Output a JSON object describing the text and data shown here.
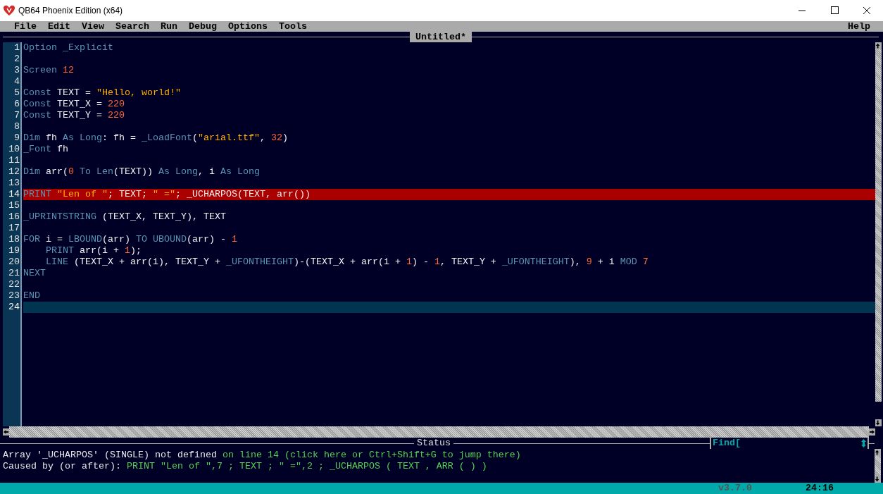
{
  "window": {
    "title": "QB64 Phoenix Edition (x64)"
  },
  "menu": {
    "items": [
      "File",
      "Edit",
      "View",
      "Search",
      "Run",
      "Debug",
      "Options",
      "Tools"
    ],
    "help": "Help"
  },
  "editor": {
    "tab": "Untitled*",
    "lines": [
      {
        "number": "1",
        "error": false,
        "current": false,
        "tokens": [
          {
            "kind": "keyword",
            "text": "Option _Explicit"
          }
        ]
      },
      {
        "number": "2",
        "error": false,
        "current": false
      },
      {
        "number": "3",
        "error": false,
        "current": false,
        "tokens": [
          {
            "kind": "keyword",
            "text": "Screen "
          },
          {
            "kind": "number",
            "text": "12"
          }
        ]
      },
      {
        "number": "4",
        "error": false,
        "current": false
      },
      {
        "number": "5",
        "error": false,
        "current": false,
        "tokens": [
          {
            "kind": "keyword",
            "text": "Const "
          },
          {
            "kind": "plain",
            "text": "TEXT = "
          },
          {
            "kind": "string",
            "text": "\"Hello, world!\""
          }
        ]
      },
      {
        "number": "6",
        "error": false,
        "current": false,
        "tokens": [
          {
            "kind": "keyword",
            "text": "Const "
          },
          {
            "kind": "plain",
            "text": "TEXT_X = "
          },
          {
            "kind": "number",
            "text": "220"
          }
        ]
      },
      {
        "number": "7",
        "error": false,
        "current": false,
        "tokens": [
          {
            "kind": "keyword",
            "text": "Const "
          },
          {
            "kind": "plain",
            "text": "TEXT_Y = "
          },
          {
            "kind": "number",
            "text": "220"
          }
        ]
      },
      {
        "number": "8",
        "error": false,
        "current": false
      },
      {
        "number": "9",
        "error": false,
        "current": false,
        "tokens": [
          {
            "kind": "keyword",
            "text": "Dim "
          },
          {
            "kind": "plain",
            "text": "fh "
          },
          {
            "kind": "keyword",
            "text": "As Long"
          },
          {
            "kind": "plain",
            "text": ": fh = "
          },
          {
            "kind": "keyword",
            "text": "_LoadFont"
          },
          {
            "kind": "plain",
            "text": "("
          },
          {
            "kind": "string",
            "text": "\"arial.ttf\""
          },
          {
            "kind": "plain",
            "text": ", "
          },
          {
            "kind": "number",
            "text": "32"
          },
          {
            "kind": "plain",
            "text": ")"
          }
        ]
      },
      {
        "number": "10",
        "error": false,
        "current": false,
        "tokens": [
          {
            "kind": "keyword",
            "text": "_Font "
          },
          {
            "kind": "plain",
            "text": "fh"
          }
        ]
      },
      {
        "number": "11",
        "error": false,
        "current": false
      },
      {
        "number": "12",
        "error": false,
        "current": false,
        "tokens": [
          {
            "kind": "keyword",
            "text": "Dim "
          },
          {
            "kind": "plain",
            "text": "arr("
          },
          {
            "kind": "number",
            "text": "0"
          },
          {
            "kind": "keyword",
            "text": " To Len"
          },
          {
            "kind": "plain",
            "text": "(TEXT)) "
          },
          {
            "kind": "keyword",
            "text": "As Long"
          },
          {
            "kind": "plain",
            "text": ", i "
          },
          {
            "kind": "keyword",
            "text": "As Long"
          }
        ]
      },
      {
        "number": "13",
        "error": false,
        "current": false
      },
      {
        "number": "14",
        "error": true,
        "current": false,
        "tokens": [
          {
            "kind": "keyword",
            "text": "PRINT "
          },
          {
            "kind": "string",
            "text": "\"Len of \""
          },
          {
            "kind": "plain",
            "text": "; TEXT; "
          },
          {
            "kind": "string",
            "text": "\" =\""
          },
          {
            "kind": "plain",
            "text": "; _UCHARPOS(TEXT, arr())"
          }
        ]
      },
      {
        "number": "15",
        "error": false,
        "current": false
      },
      {
        "number": "16",
        "error": false,
        "current": false,
        "tokens": [
          {
            "kind": "keyword",
            "text": "_UPRINTSTRING "
          },
          {
            "kind": "plain",
            "text": "(TEXT_X, TEXT_Y), TEXT"
          }
        ]
      },
      {
        "number": "17",
        "error": false,
        "current": false
      },
      {
        "number": "18",
        "error": false,
        "current": false,
        "tokens": [
          {
            "kind": "keyword",
            "text": "FOR "
          },
          {
            "kind": "plain",
            "text": "i = "
          },
          {
            "kind": "keyword",
            "text": "LBOUND"
          },
          {
            "kind": "plain",
            "text": "(arr) "
          },
          {
            "kind": "keyword",
            "text": "TO UBOUND"
          },
          {
            "kind": "plain",
            "text": "(arr) - "
          },
          {
            "kind": "number",
            "text": "1"
          }
        ]
      },
      {
        "number": "19",
        "error": false,
        "current": false,
        "tokens": [
          {
            "kind": "keyword",
            "text": "    PRINT "
          },
          {
            "kind": "plain",
            "text": "arr(i + "
          },
          {
            "kind": "number",
            "text": "1"
          },
          {
            "kind": "plain",
            "text": ");"
          }
        ]
      },
      {
        "number": "20",
        "error": false,
        "current": false,
        "tokens": [
          {
            "kind": "keyword",
            "text": "    LINE "
          },
          {
            "kind": "plain",
            "text": "(TEXT_X + arr(i), TEXT_Y + "
          },
          {
            "kind": "keyword",
            "text": "_UFONTHEIGHT"
          },
          {
            "kind": "plain",
            "text": ")-(TEXT_X + arr(i + "
          },
          {
            "kind": "number",
            "text": "1"
          },
          {
            "kind": "plain",
            "text": ") - "
          },
          {
            "kind": "number",
            "text": "1"
          },
          {
            "kind": "plain",
            "text": ", TEXT_Y + "
          },
          {
            "kind": "keyword",
            "text": "_UFONTHEIGHT"
          },
          {
            "kind": "plain",
            "text": "), "
          },
          {
            "kind": "number",
            "text": "9"
          },
          {
            "kind": "plain",
            "text": " + i "
          },
          {
            "kind": "keyword",
            "text": "MOD "
          },
          {
            "kind": "number",
            "text": "7"
          }
        ]
      },
      {
        "number": "21",
        "error": false,
        "current": false,
        "tokens": [
          {
            "kind": "keyword",
            "text": "NEXT"
          }
        ]
      },
      {
        "number": "22",
        "error": false,
        "current": false
      },
      {
        "number": "23",
        "error": false,
        "current": false,
        "tokens": [
          {
            "kind": "keyword",
            "text": "END"
          }
        ]
      },
      {
        "number": "24",
        "error": false,
        "current": true
      }
    ]
  },
  "status": {
    "title": "Status",
    "find_label": "Find[",
    "messages": [
      {
        "segments": [
          {
            "kind": "plain",
            "text": "Array '_UCHARPOS' (SINGLE) not defined "
          },
          {
            "kind": "link",
            "text": "on line 14 (click here or Ctrl+Shift+G to jump there)"
          }
        ]
      },
      {
        "segments": [
          {
            "kind": "plain",
            "text": "Caused by (or after): "
          },
          {
            "kind": "link",
            "text": "PRINT \"Len of \",7 ; TEXT ; \" =\",2 ; _UCHARPOS ( TEXT , ARR ( ) )"
          }
        ]
      }
    ]
  },
  "status_bar": {
    "version": "v3.7.0",
    "position": "24:16"
  }
}
